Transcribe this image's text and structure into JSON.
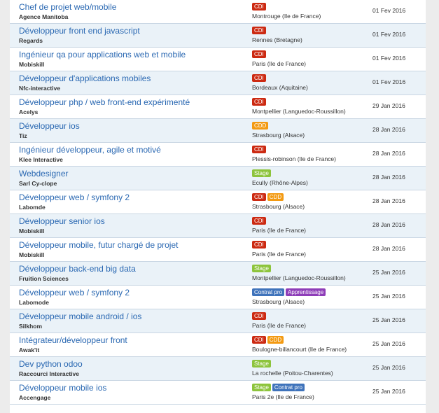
{
  "colors": {
    "CDI": "#cc2a12",
    "CDD": "#f39a12",
    "Stage": "#8dc43c",
    "Contrat pro": "#3f73bb",
    "Apprentissage": "#8e3db8"
  },
  "jobs": [
    {
      "title": "Chef de projet web/mobile",
      "company": "Agence Manitoba",
      "badges": [
        "CDI"
      ],
      "location": "Montrouge (Ile de France)",
      "date": "01 Fev 2016"
    },
    {
      "title": "Développeur front end javascript",
      "company": "Regards",
      "badges": [
        "CDI"
      ],
      "location": "Rennes (Bretagne)",
      "date": "01 Fev 2016"
    },
    {
      "title": "Ingénieur qa pour applications web et mobile",
      "company": "Mobiskill",
      "badges": [
        "CDI"
      ],
      "location": "Paris (Ile de France)",
      "date": "01 Fev 2016"
    },
    {
      "title": "Développeur d'applications mobiles",
      "company": "Nfc-interactive",
      "badges": [
        "CDI"
      ],
      "location": "Bordeaux (Aquitaine)",
      "date": "01 Fev 2016"
    },
    {
      "title": "Développeur php / web front-end expérimenté",
      "company": "Acelys",
      "badges": [
        "CDI"
      ],
      "location": "Montpellier (Languedoc-Roussillon)",
      "date": "29 Jan 2016"
    },
    {
      "title": "Développeur ios",
      "company": "Tiz",
      "badges": [
        "CDD"
      ],
      "location": "Strasbourg (Alsace)",
      "date": "28 Jan 2016"
    },
    {
      "title": "Ingénieur développeur, agile et motivé",
      "company": "Klee Interactive",
      "badges": [
        "CDI"
      ],
      "location": "Plessis-robinson (Ile de France)",
      "date": "28 Jan 2016"
    },
    {
      "title": "Webdesigner",
      "company": "Sarl Cy-clope",
      "badges": [
        "Stage"
      ],
      "location": "Ecully (Rhône-Alpes)",
      "date": "28 Jan 2016"
    },
    {
      "title": "Développeur web / symfony 2",
      "company": "Labomde",
      "badges": [
        "CDI",
        "CDD"
      ],
      "location": "Strasbourg (Alsace)",
      "date": "28 Jan 2016"
    },
    {
      "title": "Développeur senior ios",
      "company": "Mobiskill",
      "badges": [
        "CDI"
      ],
      "location": "Paris (Ile de France)",
      "date": "28 Jan 2016"
    },
    {
      "title": "Développeur mobile, futur chargé de projet",
      "company": "Mobiskill",
      "badges": [
        "CDI"
      ],
      "location": "Paris (Ile de France)",
      "date": "28 Jan 2016"
    },
    {
      "title": "Développeur back-end big data",
      "company": "Fruition Sciences",
      "badges": [
        "Stage"
      ],
      "location": "Montpellier (Languedoc-Roussillon)",
      "date": "25 Jan 2016"
    },
    {
      "title": "Développeur web / symfony 2",
      "company": "Labomode",
      "badges": [
        "Contrat pro",
        "Apprentissage"
      ],
      "location": "Strasbourg (Alsace)",
      "date": "25 Jan 2016"
    },
    {
      "title": "Développeur mobile android / ios",
      "company": "Silkhom",
      "badges": [
        "CDI"
      ],
      "location": "Paris (Ile de France)",
      "date": "25 Jan 2016"
    },
    {
      "title": "Intégrateur/développeur front",
      "company": "Awak'it",
      "badges": [
        "CDI",
        "CDD"
      ],
      "location": "Boulogne-billancourt (Ile de France)",
      "date": "25 Jan 2016"
    },
    {
      "title": "Dev python odoo",
      "company": "Raccourci Interactive",
      "badges": [
        "Stage"
      ],
      "location": "La rochelle (Poitou-Charentes)",
      "date": "25 Jan 2016"
    },
    {
      "title": "Développeur mobile ios",
      "company": "Accengage",
      "badges": [
        "Stage",
        "Contrat pro"
      ],
      "location": "Paris 2e (Ile de France)",
      "date": "25 Jan 2016"
    }
  ]
}
